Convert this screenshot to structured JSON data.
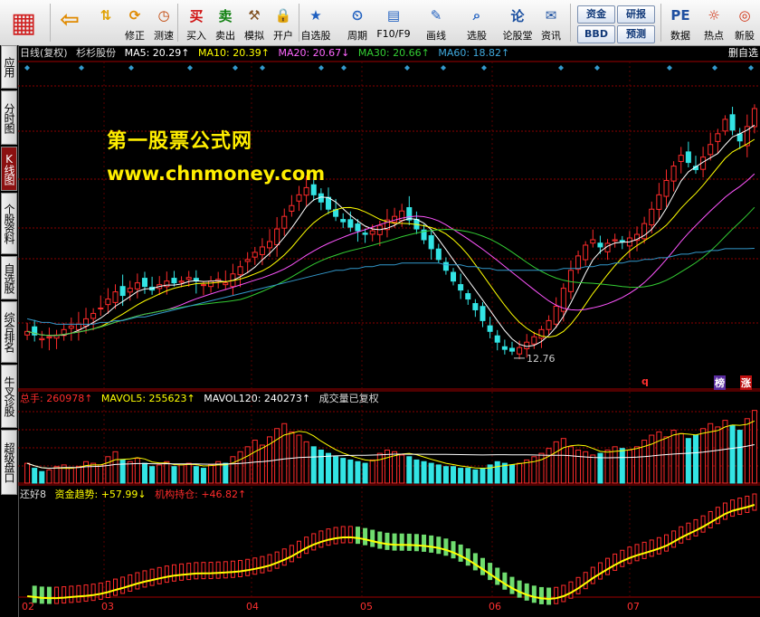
{
  "toolbar": {
    "items": [
      {
        "name": "home",
        "label": "",
        "icon": "grid-logo-icon"
      },
      {
        "name": "back",
        "label": "",
        "icon": "back-arrow-icon"
      },
      {
        "name": "updown",
        "label": "",
        "icon": "up-down-arrows-icon"
      },
      {
        "name": "fix",
        "label": "修正",
        "icon": "refresh-circle-icon"
      },
      {
        "name": "speed",
        "label": "测速",
        "icon": "clock-icon"
      },
      {
        "name": "buy",
        "label": "买入",
        "icon": "buy-icon"
      },
      {
        "name": "sell",
        "label": "卖出",
        "icon": "sell-icon"
      },
      {
        "name": "simulate",
        "label": "模拟",
        "icon": "hammer-icon"
      },
      {
        "name": "open",
        "label": "开户",
        "icon": "lock-icon"
      },
      {
        "name": "watchlist",
        "label": "自选股",
        "icon": "star-folder-icon"
      },
      {
        "name": "period",
        "label": "周期",
        "icon": "period-icon"
      },
      {
        "name": "f10",
        "label": "F10/F9",
        "icon": "f10-icon"
      },
      {
        "name": "draw",
        "label": "画线",
        "icon": "pencil-icon"
      },
      {
        "name": "select",
        "label": "选股",
        "icon": "select-stock-icon"
      },
      {
        "name": "forum",
        "label": "论股堂",
        "icon": "forum-icon"
      },
      {
        "name": "news",
        "label": "资讯",
        "icon": "news-icon"
      },
      {
        "name": "data",
        "label": "数据",
        "icon": "pe-icon"
      },
      {
        "name": "hot",
        "label": "热点",
        "icon": "hot-icon"
      },
      {
        "name": "newstock",
        "label": "新股",
        "icon": "new-stock-icon"
      }
    ],
    "pills": {
      "fund": "资金",
      "research": "研报",
      "bbd": "BBD",
      "forecast": "预测"
    }
  },
  "sidebar": {
    "items": [
      {
        "label": "应用",
        "active": false
      },
      {
        "label": "分时图",
        "active": false
      },
      {
        "label": "K线图",
        "active": true
      },
      {
        "label": "个股资料",
        "active": false
      },
      {
        "label": "自选股",
        "active": false
      },
      {
        "label": "综合排名",
        "active": false
      },
      {
        "label": "牛叉诊股",
        "active": false
      },
      {
        "label": "超级盘口",
        "active": false
      }
    ]
  },
  "header": {
    "period": "日线(复权)",
    "stock_name": "杉杉股份",
    "ma5": "MA5: 20.29↑",
    "ma10": "MA10: 20.39↑",
    "ma20": "MA20: 20.67↓",
    "ma30": "MA30: 20.66↑",
    "ma60": "MA60: 18.82↑",
    "right_label": "删自选"
  },
  "colors": {
    "up": "#ff2b2b",
    "down": "#33e4e4",
    "ma5": "#ffffff",
    "ma10": "#ffff00",
    "ma20": "#ff55ff",
    "ma30": "#33cc33",
    "ma60": "#3399cc",
    "grid": "#8b0000",
    "yellow": "#ffee00"
  },
  "watermark": {
    "line1": "第一股票公式网",
    "line2": "www.chnmoney.com"
  },
  "price_pane": {
    "low_label": "12.76",
    "badges": {
      "q": "q",
      "bang": "榜",
      "zhang": "涨"
    }
  },
  "volume_pane": {
    "total": "总手: 260978↑",
    "mavol5": "MAVOL5: 255623↑",
    "mavol120": "MAVOL120: 240273↑",
    "note": "成交量已复权"
  },
  "indicator_pane": {
    "name": "还好8",
    "fund_trend": "资金趋势: +57.99↓",
    "inst": "机构持仓: +46.82↑"
  },
  "x_axis": [
    "02",
    "03",
    "04",
    "05",
    "06",
    "07"
  ],
  "chart_data": {
    "type": "candlestick",
    "symbol": "杉杉股份",
    "period": "日线(复权)",
    "low_marker": 12.76,
    "close_series": [
      14.2,
      14.0,
      13.8,
      13.9,
      14.0,
      14.3,
      14.5,
      14.6,
      14.9,
      15.2,
      15.5,
      16.0,
      16.4,
      16.2,
      16.6,
      16.9,
      16.7,
      16.5,
      16.8,
      17.0,
      16.9,
      17.0,
      17.2,
      17.0,
      16.8,
      17.0,
      17.1,
      16.9,
      17.4,
      17.8,
      18.2,
      18.6,
      18.9,
      19.2,
      19.9,
      20.6,
      21.2,
      21.8,
      22.2,
      21.8,
      21.4,
      21.0,
      20.6,
      20.3,
      20.0,
      19.8,
      19.6,
      19.8,
      20.1,
      20.4,
      20.6,
      20.9,
      20.4,
      19.9,
      19.3,
      18.8,
      18.2,
      17.6,
      17.0,
      16.5,
      16.0,
      15.4,
      14.8,
      14.2,
      13.6,
      13.2,
      13.1,
      13.3,
      13.6,
      13.9,
      14.3,
      14.8,
      15.6,
      16.6,
      17.6,
      18.4,
      19.0,
      19.3,
      18.9,
      19.1,
      19.3,
      19.2,
      19.4,
      19.6,
      20.2,
      21.0,
      21.8,
      22.6,
      23.4,
      24.0,
      23.6,
      23.2,
      23.9,
      24.6,
      25.2,
      26.0,
      25.4,
      24.8,
      25.6,
      26.6
    ],
    "volume_series": [
      1.2,
      0.9,
      0.7,
      0.8,
      1.0,
      1.1,
      0.9,
      1.0,
      1.3,
      1.2,
      1.1,
      1.6,
      1.9,
      1.4,
      1.3,
      1.5,
      1.2,
      1.0,
      1.1,
      1.3,
      1.0,
      1.1,
      1.2,
      1.0,
      0.9,
      1.1,
      1.3,
      1.2,
      1.6,
      1.9,
      2.2,
      2.6,
      2.3,
      2.8,
      3.3,
      3.6,
      3.1,
      2.9,
      2.5,
      2.2,
      2.0,
      1.8,
      1.6,
      1.5,
      1.4,
      1.3,
      1.2,
      1.4,
      1.8,
      2.0,
      1.9,
      1.7,
      1.6,
      1.4,
      1.3,
      1.2,
      1.1,
      1.0,
      1.0,
      0.9,
      0.9,
      0.8,
      0.9,
      1.1,
      1.3,
      1.2,
      1.1,
      1.2,
      1.4,
      1.6,
      1.8,
      2.1,
      2.5,
      2.7,
      2.2,
      2.0,
      1.9,
      1.7,
      1.8,
      2.0,
      2.2,
      2.1,
      2.0,
      2.2,
      2.6,
      2.9,
      3.1,
      2.8,
      3.2,
      3.0,
      2.7,
      2.9,
      3.3,
      3.6,
      3.4,
      3.8,
      3.5,
      3.2,
      3.9,
      4.4
    ],
    "ma60_series": [
      14.9,
      14.8,
      14.7,
      14.7,
      14.6,
      14.6,
      14.6,
      14.6,
      14.6,
      14.6,
      14.7,
      14.7,
      14.8,
      14.8,
      14.9,
      15.0,
      15.0,
      15.1,
      15.2,
      15.3,
      15.4,
      15.5,
      15.6,
      15.7,
      15.8,
      15.9,
      16.0,
      16.1,
      16.2,
      16.3,
      16.4,
      16.5,
      16.6,
      16.7,
      16.8,
      16.9,
      17.0,
      17.1,
      17.2,
      17.3,
      17.4,
      17.5,
      17.6,
      17.6,
      17.7,
      17.7,
      17.8,
      17.8,
      17.9,
      17.9,
      17.9,
      18.0,
      18.0,
      18.0,
      18.0,
      18.0,
      18.0,
      17.9,
      17.9,
      17.9,
      17.8,
      17.8,
      17.7,
      17.7,
      17.6,
      17.6,
      17.6,
      17.6,
      17.6,
      17.6,
      17.6,
      17.6,
      17.6,
      17.7,
      17.7,
      17.7,
      17.8,
      17.8,
      17.9,
      17.9,
      18.0,
      18.0,
      18.1,
      18.1,
      18.2,
      18.2,
      18.3,
      18.3,
      18.4,
      18.5,
      18.5,
      18.6,
      18.6,
      18.7,
      18.7,
      18.8,
      18.8,
      18.8,
      18.8,
      18.82
    ]
  }
}
